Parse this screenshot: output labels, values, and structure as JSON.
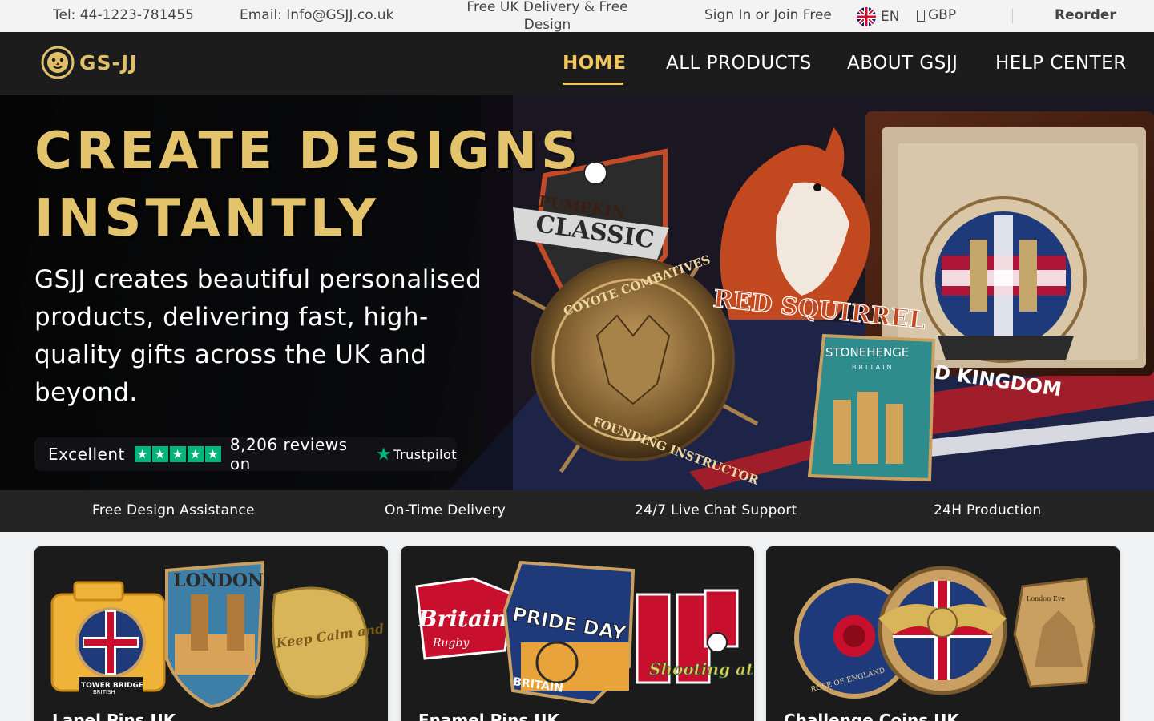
{
  "topbar": {
    "tel": "Tel: 44-1223-781455",
    "email": "Email: Info@GSJJ.co.uk",
    "promo": "Free UK Delivery & Free Design",
    "signin": "Sign In or Join Free",
    "language": "EN",
    "currency": "GBP",
    "reorder": "Reorder"
  },
  "nav": {
    "logo_text": "GS-JJ",
    "items": [
      {
        "label": "HOME",
        "active": true
      },
      {
        "label": "ALL PRODUCTS",
        "active": false
      },
      {
        "label": "ABOUT GSJJ",
        "active": false
      },
      {
        "label": "HELP CENTER",
        "active": false
      }
    ]
  },
  "hero": {
    "title": "CREATE DESIGNS\nINSTANTLY",
    "subtitle": "GSJJ creates beautiful personalised products, delivering fast, high-quality gifts across the UK and beyond.",
    "art_labels": {
      "pumpkin": "PUMPKIN",
      "classic": "CLASSIC",
      "coyote": "COYOTE COMBATIVES",
      "founding": "FOUNDING INSTRUCTOR",
      "squirrel": "RED SQUIRREL",
      "stonehenge": "STONEHENGE",
      "britain": "BRITAIN",
      "kingdom": "D KINGDOM"
    },
    "trust": {
      "rating_label": "Excellent",
      "stars": 5,
      "reviews": "8,206 reviews on",
      "brand": "Trustpilot"
    }
  },
  "features": [
    "Free Design Assistance",
    "On-Time Delivery",
    "24/7 Live Chat Support",
    "24H Production"
  ],
  "cards": [
    {
      "title": "Lapel Pins UK",
      "labels": [
        "LONDON",
        "TOWER BRIDGE",
        "BRITISH",
        "Keep Calm and Carry On"
      ]
    },
    {
      "title": "Enamel Pins UK",
      "labels": [
        "Britain",
        "Rugby",
        "PRIDE DAY",
        "BRITAIN",
        "Shooting at the goal"
      ]
    },
    {
      "title": "Challenge Coins UK",
      "labels": [
        "ROSE OF ENGLAND",
        "London Eye"
      ]
    }
  ],
  "colors": {
    "gold": "#e3c46c",
    "nav_active": "#f0c55c",
    "nav_bg": "#1c1c1c",
    "trustpilot_green": "#00b67a"
  }
}
